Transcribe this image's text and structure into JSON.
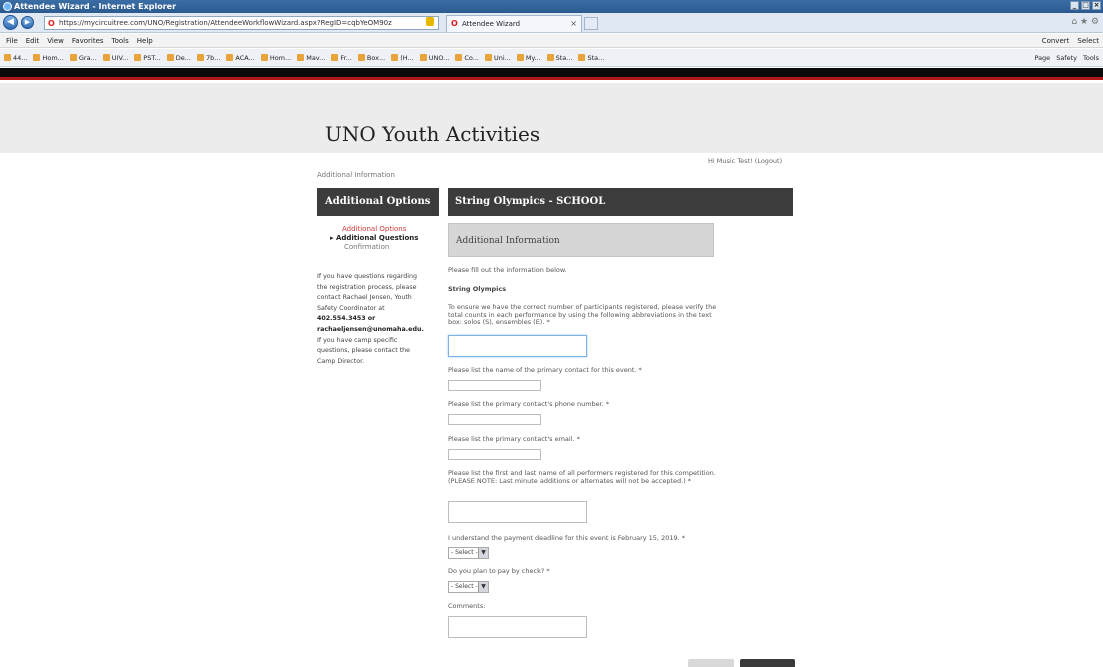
{
  "browser": {
    "window_title": "Attendee Wizard - Internet Explorer",
    "address": "https://mycircuitree.com/UNO/Registration/AttendeeWorkflowWizard.aspx?RegID=cqbYeOM90z",
    "tab_title": "Attendee Wizard",
    "menu": [
      "File",
      "Edit",
      "View",
      "Favorites",
      "Tools",
      "Help"
    ],
    "menu_right": [
      "Convert",
      "Select"
    ],
    "favorites": [
      "44...",
      "Hom...",
      "Gra...",
      "UIV...",
      "PST...",
      "De...",
      "7b...",
      "ACA...",
      "Hom...",
      "Mav...",
      "Fr...",
      "Box...",
      "(H...",
      "UNO...",
      "Co...",
      "Uni...",
      "My...",
      "Sta...",
      "Sta..."
    ],
    "commands": [
      "Page",
      "Safety",
      "Tools"
    ]
  },
  "site": {
    "title": "UNO Youth Activities",
    "page_subtitle": "Additional Information",
    "greeting": "Hi Music Test! (Logout)"
  },
  "sidebar": {
    "header": "Additional Options",
    "steps": [
      {
        "label": "Additional Options",
        "state": "done"
      },
      {
        "label": "▸ Additional Questions",
        "state": "current"
      },
      {
        "label": "Confirmation",
        "state": "pending"
      }
    ],
    "info_lines": [
      "If you have questions regarding",
      "the registration process, please",
      "contact Rachael Jensen, Youth",
      "Safety Coordinator at",
      "402.554.3453 or",
      "rachaeljensen@unomaha.edu.",
      "If you have camp specific",
      "questions, please contact the",
      "Camp Director."
    ]
  },
  "main": {
    "header": "String Olympics - SCHOOL",
    "section_header": "Additional Information",
    "intro": "Please fill out the information below.",
    "group_title": "String Olympics",
    "questions": {
      "q1": "To ensure we have the correct number of participants registered, please verify the total counts in each performance by using the following abbreviations in the text box: solos (S), ensembles (E). *",
      "q2": "Please list the name of the primary contact for this event. *",
      "q3": "Please list the primary contact's phone number. *",
      "q4": "Please list the primary contact's email. *",
      "q5": "Please list the first and last name of all performers registered for this competition. (PLEASE NOTE: Last minute additions or alternates will not be accepted.) *",
      "q6": "I understand the payment deadline for this event is February 15, 2019. *",
      "q7": "Do you plan to pay by check? *",
      "q8": "Comments:"
    },
    "select_placeholder": "- Select -"
  },
  "colors": {
    "header_dark": "#3c3c3c",
    "accent_red": "#b01818",
    "active_step": "#d23a3a"
  }
}
